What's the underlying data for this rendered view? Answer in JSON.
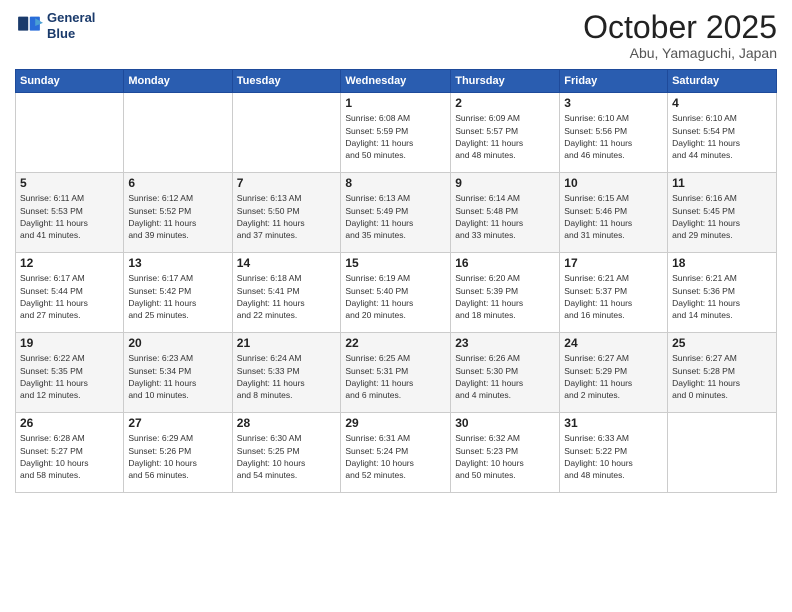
{
  "header": {
    "logo_line1": "General",
    "logo_line2": "Blue",
    "month": "October 2025",
    "location": "Abu, Yamaguchi, Japan"
  },
  "weekdays": [
    "Sunday",
    "Monday",
    "Tuesday",
    "Wednesday",
    "Thursday",
    "Friday",
    "Saturday"
  ],
  "weeks": [
    [
      {
        "day": "",
        "info": ""
      },
      {
        "day": "",
        "info": ""
      },
      {
        "day": "",
        "info": ""
      },
      {
        "day": "1",
        "info": "Sunrise: 6:08 AM\nSunset: 5:59 PM\nDaylight: 11 hours\nand 50 minutes."
      },
      {
        "day": "2",
        "info": "Sunrise: 6:09 AM\nSunset: 5:57 PM\nDaylight: 11 hours\nand 48 minutes."
      },
      {
        "day": "3",
        "info": "Sunrise: 6:10 AM\nSunset: 5:56 PM\nDaylight: 11 hours\nand 46 minutes."
      },
      {
        "day": "4",
        "info": "Sunrise: 6:10 AM\nSunset: 5:54 PM\nDaylight: 11 hours\nand 44 minutes."
      }
    ],
    [
      {
        "day": "5",
        "info": "Sunrise: 6:11 AM\nSunset: 5:53 PM\nDaylight: 11 hours\nand 41 minutes."
      },
      {
        "day": "6",
        "info": "Sunrise: 6:12 AM\nSunset: 5:52 PM\nDaylight: 11 hours\nand 39 minutes."
      },
      {
        "day": "7",
        "info": "Sunrise: 6:13 AM\nSunset: 5:50 PM\nDaylight: 11 hours\nand 37 minutes."
      },
      {
        "day": "8",
        "info": "Sunrise: 6:13 AM\nSunset: 5:49 PM\nDaylight: 11 hours\nand 35 minutes."
      },
      {
        "day": "9",
        "info": "Sunrise: 6:14 AM\nSunset: 5:48 PM\nDaylight: 11 hours\nand 33 minutes."
      },
      {
        "day": "10",
        "info": "Sunrise: 6:15 AM\nSunset: 5:46 PM\nDaylight: 11 hours\nand 31 minutes."
      },
      {
        "day": "11",
        "info": "Sunrise: 6:16 AM\nSunset: 5:45 PM\nDaylight: 11 hours\nand 29 minutes."
      }
    ],
    [
      {
        "day": "12",
        "info": "Sunrise: 6:17 AM\nSunset: 5:44 PM\nDaylight: 11 hours\nand 27 minutes."
      },
      {
        "day": "13",
        "info": "Sunrise: 6:17 AM\nSunset: 5:42 PM\nDaylight: 11 hours\nand 25 minutes."
      },
      {
        "day": "14",
        "info": "Sunrise: 6:18 AM\nSunset: 5:41 PM\nDaylight: 11 hours\nand 22 minutes."
      },
      {
        "day": "15",
        "info": "Sunrise: 6:19 AM\nSunset: 5:40 PM\nDaylight: 11 hours\nand 20 minutes."
      },
      {
        "day": "16",
        "info": "Sunrise: 6:20 AM\nSunset: 5:39 PM\nDaylight: 11 hours\nand 18 minutes."
      },
      {
        "day": "17",
        "info": "Sunrise: 6:21 AM\nSunset: 5:37 PM\nDaylight: 11 hours\nand 16 minutes."
      },
      {
        "day": "18",
        "info": "Sunrise: 6:21 AM\nSunset: 5:36 PM\nDaylight: 11 hours\nand 14 minutes."
      }
    ],
    [
      {
        "day": "19",
        "info": "Sunrise: 6:22 AM\nSunset: 5:35 PM\nDaylight: 11 hours\nand 12 minutes."
      },
      {
        "day": "20",
        "info": "Sunrise: 6:23 AM\nSunset: 5:34 PM\nDaylight: 11 hours\nand 10 minutes."
      },
      {
        "day": "21",
        "info": "Sunrise: 6:24 AM\nSunset: 5:33 PM\nDaylight: 11 hours\nand 8 minutes."
      },
      {
        "day": "22",
        "info": "Sunrise: 6:25 AM\nSunset: 5:31 PM\nDaylight: 11 hours\nand 6 minutes."
      },
      {
        "day": "23",
        "info": "Sunrise: 6:26 AM\nSunset: 5:30 PM\nDaylight: 11 hours\nand 4 minutes."
      },
      {
        "day": "24",
        "info": "Sunrise: 6:27 AM\nSunset: 5:29 PM\nDaylight: 11 hours\nand 2 minutes."
      },
      {
        "day": "25",
        "info": "Sunrise: 6:27 AM\nSunset: 5:28 PM\nDaylight: 11 hours\nand 0 minutes."
      }
    ],
    [
      {
        "day": "26",
        "info": "Sunrise: 6:28 AM\nSunset: 5:27 PM\nDaylight: 10 hours\nand 58 minutes."
      },
      {
        "day": "27",
        "info": "Sunrise: 6:29 AM\nSunset: 5:26 PM\nDaylight: 10 hours\nand 56 minutes."
      },
      {
        "day": "28",
        "info": "Sunrise: 6:30 AM\nSunset: 5:25 PM\nDaylight: 10 hours\nand 54 minutes."
      },
      {
        "day": "29",
        "info": "Sunrise: 6:31 AM\nSunset: 5:24 PM\nDaylight: 10 hours\nand 52 minutes."
      },
      {
        "day": "30",
        "info": "Sunrise: 6:32 AM\nSunset: 5:23 PM\nDaylight: 10 hours\nand 50 minutes."
      },
      {
        "day": "31",
        "info": "Sunrise: 6:33 AM\nSunset: 5:22 PM\nDaylight: 10 hours\nand 48 minutes."
      },
      {
        "day": "",
        "info": ""
      }
    ]
  ]
}
